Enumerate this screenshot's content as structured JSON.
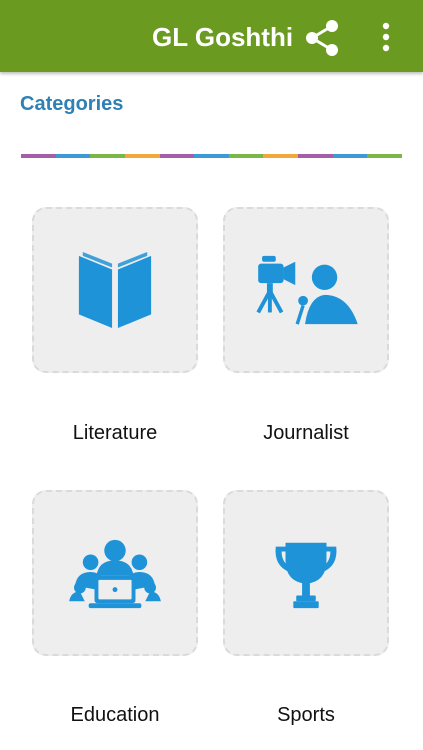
{
  "app": {
    "title": "GL Goshthi"
  },
  "toolbar": {
    "share_icon": "share-icon",
    "more_icon": "more-vert-icon"
  },
  "section": {
    "title": "Categories"
  },
  "colors": {
    "appbar": "#6a9a1f",
    "accent": "#2f80b4",
    "icon": "#1e93d8",
    "tile_bg": "#eeeeee",
    "divider": [
      "#a65fa6",
      "#3c9ad6",
      "#7ab648",
      "#f2a73b",
      "#a65fa6",
      "#3c9ad6",
      "#7ab648",
      "#f2a73b",
      "#a65fa6",
      "#3c9ad6",
      "#7ab648"
    ]
  },
  "categories": [
    {
      "label": "Literature",
      "icon": "book-icon"
    },
    {
      "label": "Journalist",
      "icon": "journalist-icon"
    },
    {
      "label": "Education",
      "icon": "education-icon"
    },
    {
      "label": "Sports",
      "icon": "trophy-icon"
    }
  ]
}
